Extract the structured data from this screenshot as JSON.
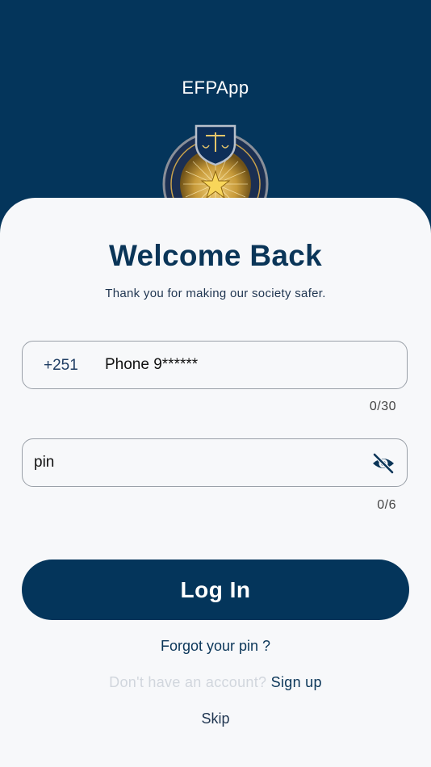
{
  "header": {
    "app_title": "EFPApp",
    "emblem_icon": "police-emblem-icon"
  },
  "login": {
    "heading": "Welcome Back",
    "subtitle": "Thank you for making our society safer.",
    "phone": {
      "country_code": "+251",
      "placeholder": "Phone 9******",
      "value": "",
      "counter": "0/30"
    },
    "pin": {
      "placeholder": "pin",
      "value": "",
      "counter": "0/6",
      "visibility_icon": "eye-off-icon"
    },
    "login_label": "Log In",
    "forgot_label": "Forgot your pin ?",
    "signup_prompt": "Don't have an account?",
    "signup_label": "Sign up",
    "skip_label": "Skip"
  },
  "colors": {
    "primary": "#04355b",
    "card_background": "#f7f8fa",
    "muted_text": "#d1d6dd"
  }
}
